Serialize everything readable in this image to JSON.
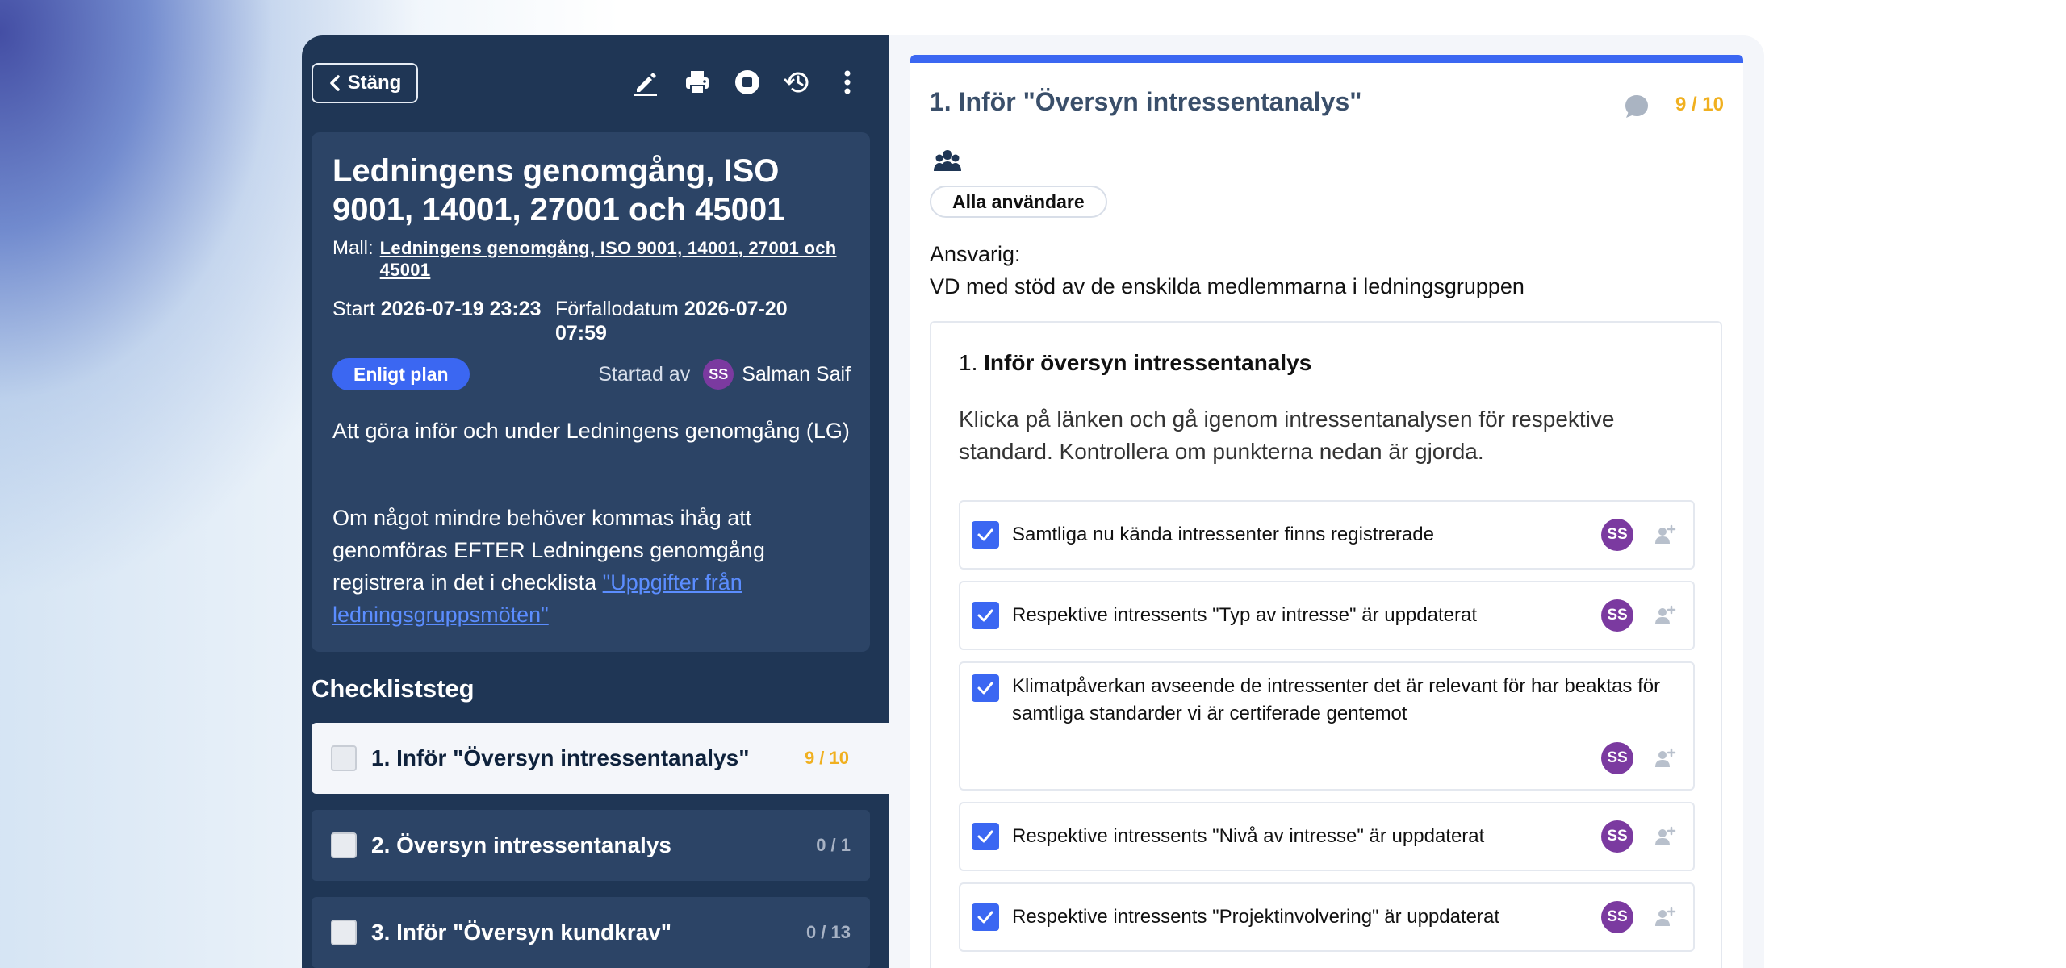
{
  "toolbar": {
    "close_label": "Stäng",
    "icons": [
      "edit-icon",
      "print-icon",
      "stop-icon",
      "history-icon",
      "more-vertical-icon"
    ]
  },
  "checklist": {
    "title": "Ledningens genomgång, ISO 9001, 14001, 27001 och 45001",
    "template_label": "Mall:",
    "template_link": "Ledningens genomgång, ISO 9001, 14001, 27001 och 45001",
    "start_label": "Start",
    "start_value": "2026-07-19 23:23",
    "due_label": "Förfallodatum",
    "due_value": "2026-07-20 07:59",
    "status": "Enligt plan",
    "started_by_label": "Startad av",
    "started_by_initials": "SS",
    "started_by_name": "Salman Saif",
    "description_1": "Att göra inför och under Ledningens genomgång (LG)",
    "description_2_text": "Om något mindre behöver kommas ihåg att genomföras EFTER Ledningens genomgång registrera in det i checklista ",
    "description_2_link": "\"Uppgifter från ledningsgruppsmöten\""
  },
  "steps": {
    "heading": "Checkliststeg",
    "items": [
      {
        "label": "1. Inför \"Översyn intressentanalys\"",
        "count": "9 / 10"
      },
      {
        "label": "2. Översyn intressentanalys",
        "count": "0 / 1"
      },
      {
        "label": "3. Inför \"Översyn kundkrav\"",
        "count": "0 / 13"
      }
    ]
  },
  "detail": {
    "title": "1. Inför \"Översyn intressentanalys\"",
    "count": "9 / 10",
    "audience_chip": "Alla användare",
    "responsible_label": "Ansvarig:",
    "responsible_value": "VD med stöd av de enskilda medlemmarna i ledningsgruppen",
    "task_number": "1.",
    "task_title": "Inför översyn intressentanalys",
    "task_description": "Klicka på länken och gå igenom intressentanalysen för respektive standard. Kontrollera om punkterna nedan är gjorda.",
    "items": [
      {
        "text": "Samtliga nu kända intressenter finns registrerade",
        "initials": "SS"
      },
      {
        "text": "Respektive intressents \"Typ av intresse\" är uppdaterat",
        "initials": "SS"
      },
      {
        "text": "Klimatpåverkan avseende de intressenter det är relevant för har beaktas för samtliga standarder vi är certiferade gentemot",
        "initials": "SS"
      },
      {
        "text": "Respektive intressents \"Nivå av intresse\" är uppdaterat",
        "initials": "SS"
      },
      {
        "text": "Respektive intressents \"Projektinvolvering\" är uppdaterat",
        "initials": "SS"
      }
    ]
  },
  "colors": {
    "sidebar_bg": "#1f3655",
    "card_bg": "#2c4466",
    "accent": "#3b67f2",
    "count_highlight": "#f0b020",
    "avatar": "#7b3aa0"
  }
}
